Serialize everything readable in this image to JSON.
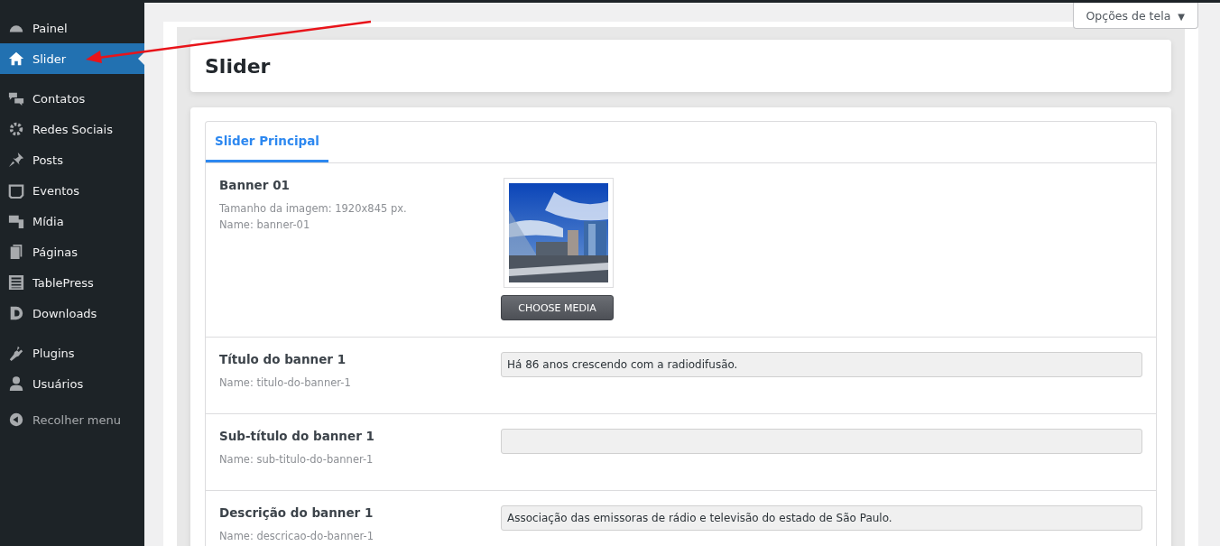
{
  "sidebar": {
    "groups": [
      {
        "items": [
          {
            "label": "Painel",
            "selected": false
          },
          {
            "label": "Slider",
            "selected": true
          }
        ]
      },
      {
        "items": [
          {
            "label": "Contatos",
            "selected": false
          },
          {
            "label": "Redes Sociais",
            "selected": false
          },
          {
            "label": "Posts",
            "selected": false
          },
          {
            "label": "Eventos",
            "selected": false
          },
          {
            "label": "Mídia",
            "selected": false
          },
          {
            "label": "Páginas",
            "selected": false
          },
          {
            "label": "TablePress",
            "selected": false
          },
          {
            "label": "Downloads",
            "selected": false
          }
        ]
      },
      {
        "items": [
          {
            "label": "Plugins",
            "selected": false
          },
          {
            "label": "Usuários",
            "selected": false
          }
        ]
      }
    ],
    "collapse": "Recolher menu"
  },
  "screen_options": {
    "label": "Opções de tela",
    "caret": "▼"
  },
  "page_title": "Slider",
  "tabs": [
    {
      "label": "Slider Principal",
      "selected": true
    }
  ],
  "fields": [
    {
      "label": "Banner 01",
      "hints": [
        "Tamanho da imagem: 1920x845 px.",
        "Name: banner-01"
      ],
      "button": "CHOOSE MEDIA"
    },
    {
      "kind": "text",
      "label": "Título do banner 1",
      "hints": [
        "Name: titulo-do-banner-1"
      ],
      "value": "Há 86 anos crescendo com a radiodifusão."
    },
    {
      "kind": "text",
      "label": "Sub-título do banner 1",
      "hints": [
        "Name: sub-titulo-do-banner-1"
      ]
    },
    {
      "kind": "text",
      "label": "Descrição do banner 1",
      "hints": [
        "Name: descricao-do-banner-1"
      ],
      "value": "Associação das emissoras de rádio e televisão do estado de São Paulo."
    }
  ]
}
